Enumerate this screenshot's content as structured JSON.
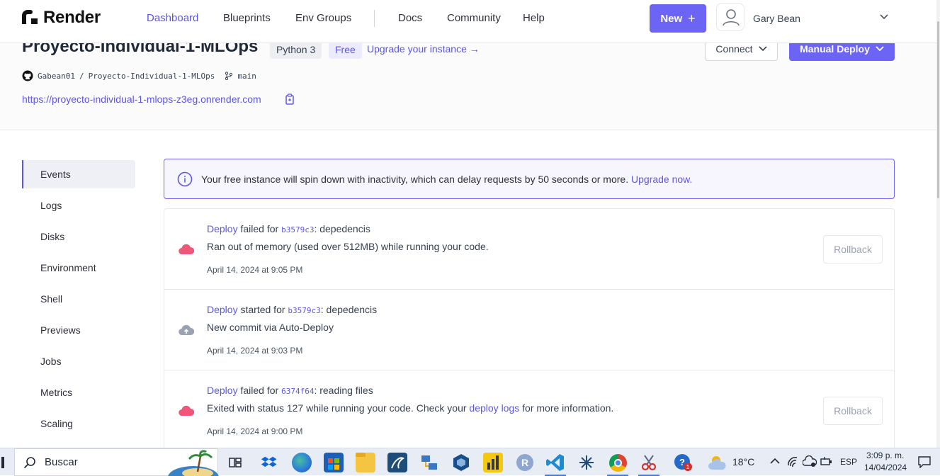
{
  "nav": {
    "logo_text": "Render",
    "links": [
      "Dashboard",
      "Blueprints",
      "Env Groups",
      "Docs",
      "Community",
      "Help"
    ],
    "active": "Dashboard",
    "new_label": "New",
    "user_name": "Gary Bean"
  },
  "service": {
    "title": "Proyecto-Individual-1-MLOps",
    "runtime_badge": "Python 3",
    "plan_badge": "Free",
    "upgrade_link": "Upgrade your instance →",
    "connect_label": "Connect",
    "manual_deploy_label": "Manual Deploy",
    "repo_owner": "Gabean01",
    "repo_sep": "/",
    "repo_name": "Proyecto-Individual-1-MLOps",
    "branch": "main",
    "url": "https://proyecto-individual-1-mlops-z3eg.onrender.com"
  },
  "sidebar": {
    "items": [
      "Events",
      "Logs",
      "Disks",
      "Environment",
      "Shell",
      "Previews",
      "Jobs",
      "Metrics",
      "Scaling"
    ],
    "active": "Events"
  },
  "banner": {
    "text": "Your free instance will spin down with inactivity, which can delay requests by 50 seconds or more.",
    "link": "Upgrade now."
  },
  "events": [
    {
      "link": "Deploy",
      "verb": " failed for ",
      "commit": "b3579c3",
      "message": ": depedencis",
      "detail_pre": "Ran out of memory (used over 512MB) while running your code.",
      "detail_link": "",
      "detail_post": "",
      "time": "April 14, 2024 at 9:05 PM",
      "status": "failed",
      "rollback": "Rollback"
    },
    {
      "link": "Deploy",
      "verb": " started for ",
      "commit": "b3579c3",
      "message": ": depedencis",
      "detail_pre": "New commit via Auto-Deploy",
      "detail_link": "",
      "detail_post": "",
      "time": "April 14, 2024 at 9:03 PM",
      "status": "started",
      "rollback": ""
    },
    {
      "link": "Deploy",
      "verb": " failed for ",
      "commit": "6374f64",
      "message": ": reading files",
      "detail_pre": "Exited with status 127 while running your code. Check your ",
      "detail_link": "deploy logs",
      "detail_post": " for more information.",
      "time": "April 14, 2024 at 9:00 PM",
      "status": "failed",
      "rollback": "Rollback"
    }
  ],
  "taskbar": {
    "search_placeholder": "Buscar",
    "temperature": "18°C",
    "language": "ESP",
    "time": "3:09 p. m.",
    "date": "14/04/2024",
    "badge_count": "1"
  },
  "colors": {
    "accent": "#6c64f4",
    "link": "#5b56e8",
    "failed": "#f0557a",
    "started": "#9aa3b2"
  }
}
